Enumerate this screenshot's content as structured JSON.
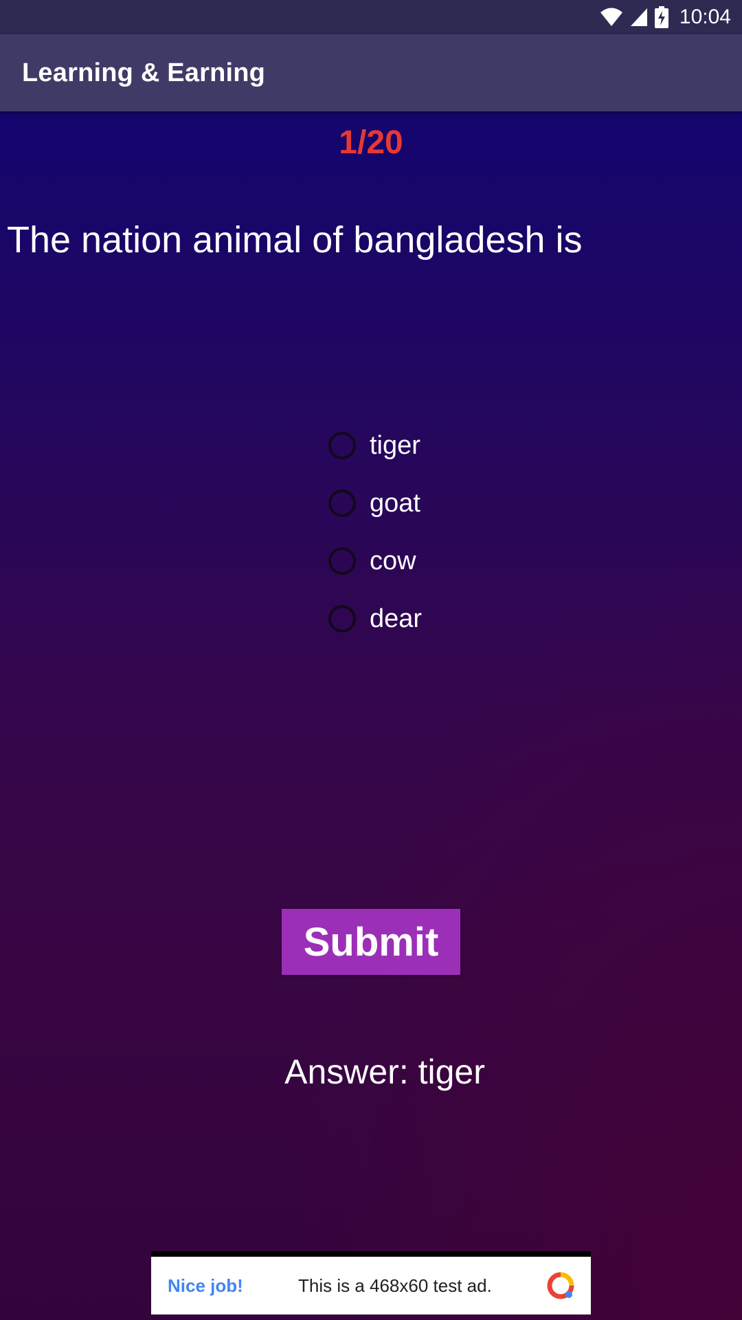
{
  "status_bar": {
    "time": "10:04",
    "icons": [
      "wifi-icon",
      "cell-signal-icon",
      "battery-charging-icon"
    ]
  },
  "app_bar": {
    "title": "Learning & Earning"
  },
  "quiz": {
    "counter": "1/20",
    "question": "The nation animal of bangladesh is",
    "options": [
      "tiger",
      "goat",
      "cow",
      "dear"
    ],
    "selected_option": null,
    "submit_label": "Submit",
    "answer_text": "Answer: tiger"
  },
  "ad": {
    "nice_label": "Nice job!",
    "text": "This is a 468x60 test ad.",
    "icon": "ad-brand-logo"
  },
  "colors": {
    "status_bar_bg": "#2e2a52",
    "app_bar_bg": "#403b66",
    "counter_color": "#e53935",
    "submit_bg": "#9c2fb8",
    "ad_link": "#4285f4"
  }
}
